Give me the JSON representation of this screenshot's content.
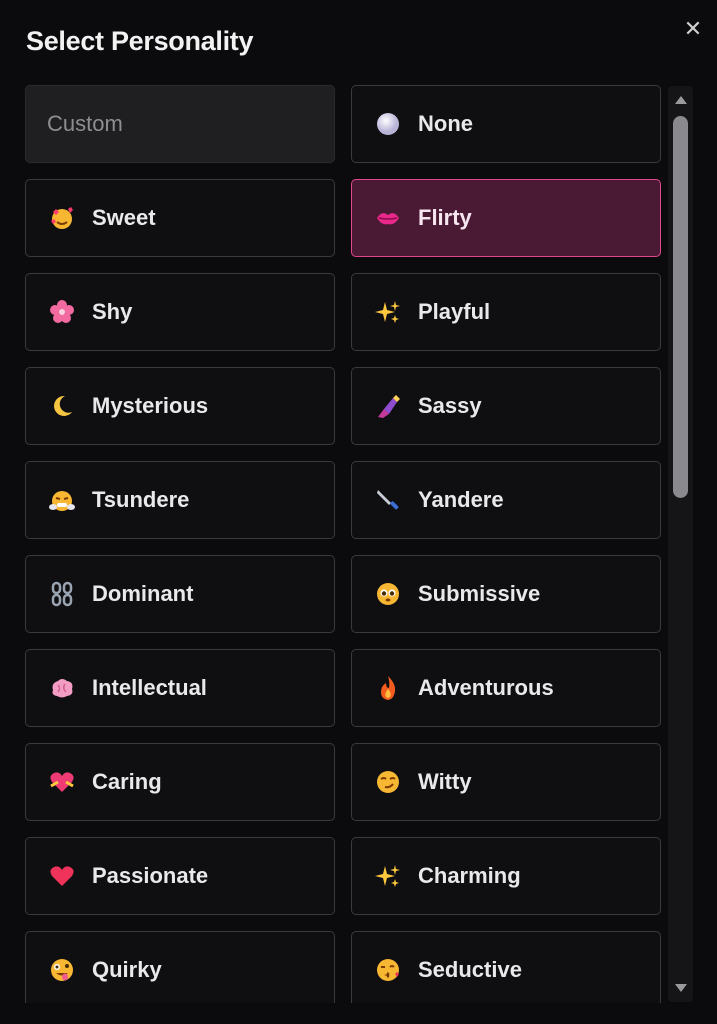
{
  "dialog": {
    "title": "Select Personality",
    "close_icon": "close-icon"
  },
  "options": [
    {
      "label": "Custom",
      "icon": "none",
      "state": "custom"
    },
    {
      "label": "None",
      "icon": "white-circle-icon",
      "state": "normal"
    },
    {
      "label": "Sweet",
      "icon": "smiling-hearts-face-icon",
      "state": "normal"
    },
    {
      "label": "Flirty",
      "icon": "kiss-lips-icon",
      "state": "selected"
    },
    {
      "label": "Shy",
      "icon": "pink-flower-icon",
      "state": "normal"
    },
    {
      "label": "Playful",
      "icon": "sparkles-icon",
      "state": "normal"
    },
    {
      "label": "Mysterious",
      "icon": "crescent-moon-icon",
      "state": "normal"
    },
    {
      "label": "Sassy",
      "icon": "nail-polish-icon",
      "state": "normal"
    },
    {
      "label": "Tsundere",
      "icon": "steam-face-icon",
      "state": "normal"
    },
    {
      "label": "Yandere",
      "icon": "knife-icon",
      "state": "normal"
    },
    {
      "label": "Dominant",
      "icon": "chains-icon",
      "state": "normal"
    },
    {
      "label": "Submissive",
      "icon": "pleading-face-icon",
      "state": "normal"
    },
    {
      "label": "Intellectual",
      "icon": "brain-icon",
      "state": "normal"
    },
    {
      "label": "Adventurous",
      "icon": "fire-icon",
      "state": "normal"
    },
    {
      "label": "Caring",
      "icon": "heart-with-ribbon-icon",
      "state": "normal"
    },
    {
      "label": "Witty",
      "icon": "smirking-face-icon",
      "state": "normal"
    },
    {
      "label": "Passionate",
      "icon": "red-heart-icon",
      "state": "normal"
    },
    {
      "label": "Charming",
      "icon": "sparkles-icon",
      "state": "normal"
    },
    {
      "label": "Quirky",
      "icon": "zany-face-icon",
      "state": "normal"
    },
    {
      "label": "Seductive",
      "icon": "kissing-face-icon",
      "state": "normal"
    }
  ],
  "colors": {
    "background": "#0b0b0d",
    "card_border": "#3a3a3e",
    "selected_bg": "#4a1a34",
    "selected_border": "#e0478f"
  },
  "scrollbar": {
    "position_fraction": 0.0,
    "visible_fraction": 0.42
  }
}
